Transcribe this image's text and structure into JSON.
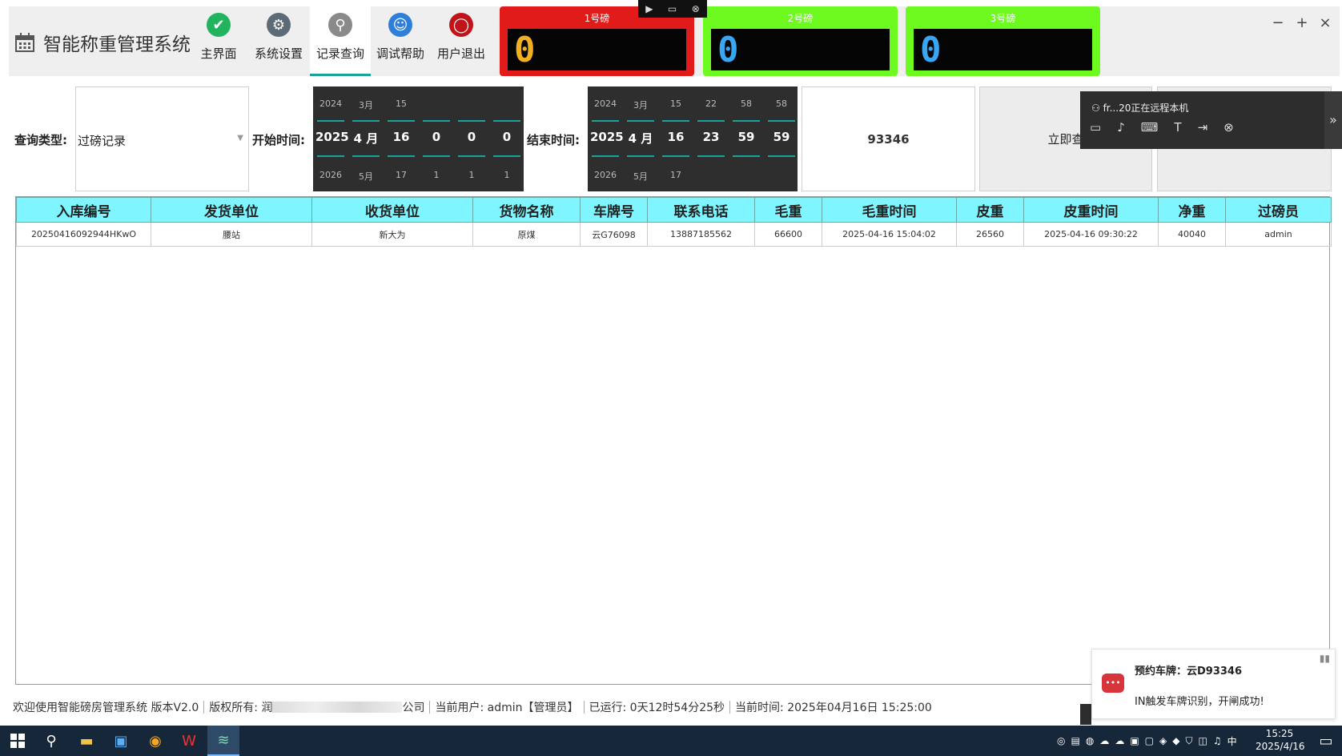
{
  "app": {
    "title": "智能称重管理系统"
  },
  "nav": [
    {
      "label": "主界面",
      "icon": "shield-icon",
      "color": "#22b35e"
    },
    {
      "label": "系统设置",
      "icon": "gear-icon",
      "color": "#5d6b78"
    },
    {
      "label": "记录查询",
      "icon": "magnifier-icon",
      "color": "#8a8a8a",
      "active": true
    },
    {
      "label": "调试帮助",
      "icon": "accessibility-icon",
      "color": "#2f7fd8"
    },
    {
      "label": "用户退出",
      "icon": "power-icon",
      "color": "#c0141b"
    }
  ],
  "scales": [
    {
      "label": "1号磅",
      "value": "0",
      "frame_color": "#e11a1a",
      "digit_color": "#f0b020"
    },
    {
      "label": "2号磅",
      "value": "0",
      "frame_color": "#6dfa1f",
      "digit_color": "#39a6f5"
    },
    {
      "label": "3号磅",
      "value": "0",
      "frame_color": "#6dfa1f",
      "digit_color": "#39a6f5"
    }
  ],
  "window_controls": {
    "minimize": "−",
    "maximize": "+",
    "close": "×"
  },
  "mini_toolbar": {
    "cursor": "▶",
    "screen": "▭",
    "close": "⊗"
  },
  "query": {
    "type_label": "查询类型:",
    "type_value": "过磅记录",
    "start_label": "开始时间:",
    "end_label": "结束时间:",
    "start": [
      {
        "prev": "2024",
        "cur": "2025",
        "next": "2026"
      },
      {
        "prev": "3月",
        "cur": "4 月",
        "next": "5月"
      },
      {
        "prev": "15",
        "cur": "16",
        "next": "17"
      },
      {
        "prev": "",
        "cur": "0",
        "next": "1"
      },
      {
        "prev": "",
        "cur": "0",
        "next": "1"
      },
      {
        "prev": "",
        "cur": "0",
        "next": "1"
      }
    ],
    "end": [
      {
        "prev": "2024",
        "cur": "2025",
        "next": "2026"
      },
      {
        "prev": "3月",
        "cur": "4 月",
        "next": "5月"
      },
      {
        "prev": "15",
        "cur": "16",
        "next": "17"
      },
      {
        "prev": "22",
        "cur": "23",
        "next": ""
      },
      {
        "prev": "58",
        "cur": "59",
        "next": ""
      },
      {
        "prev": "58",
        "cur": "59",
        "next": ""
      }
    ],
    "plate_value": "93346",
    "query_button": "立即查"
  },
  "remote_popup": {
    "text": "fr...20正在远程本机",
    "expand": "»"
  },
  "table": {
    "headers": [
      "入库编号",
      "发货单位",
      "收货单位",
      "货物名称",
      "车牌号",
      "联系电话",
      "毛重",
      "毛重时间",
      "皮重",
      "皮重时间",
      "净重",
      "过磅员"
    ],
    "rows": [
      [
        "20250416092944HKwO",
        "腰站",
        "新大为",
        "原煤",
        "云G76098",
        "13887185562",
        "66600",
        "2025-04-16 15:04:02",
        "26560",
        "2025-04-16 09:30:22",
        "40040",
        "admin"
      ]
    ]
  },
  "status_bar": {
    "welcome": "欢迎使用智能磅房管理系统 版本V2.0",
    "copyright_prefix": "版权所有: 润",
    "copyright_suffix": "公司",
    "user": "当前用户: admin【管理员】",
    "uptime": "已运行: 0天12时54分25秒",
    "time": "当前时间: 2025年04月16日 15:25:00"
  },
  "toast": {
    "title": "预约车牌：云D93346",
    "message": "IN触发车牌识别，开闸成功!"
  },
  "taskbar": {
    "ime": "中",
    "time": "15:25",
    "date": "2025/4/16"
  }
}
